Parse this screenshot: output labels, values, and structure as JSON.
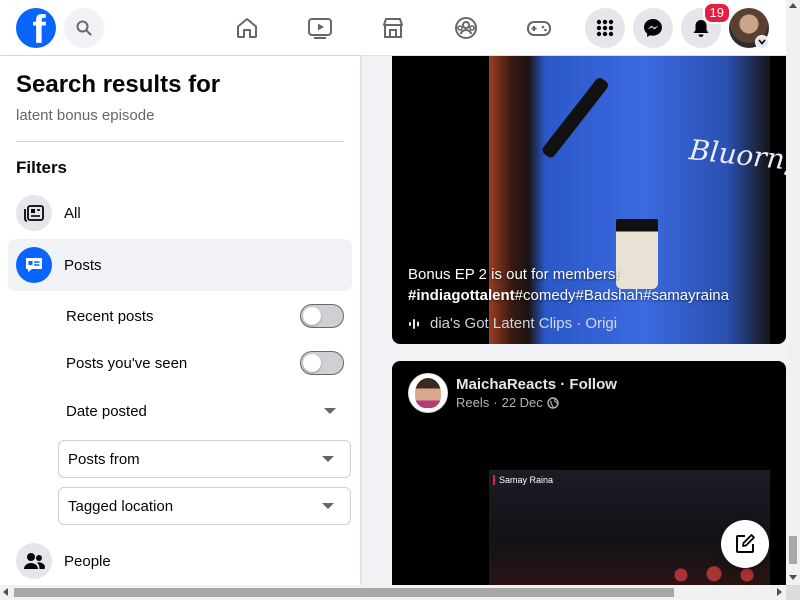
{
  "colors": {
    "brand": "#0866ff",
    "badge": "#e41e3f",
    "text_secondary": "#65676b"
  },
  "topbar": {
    "logo_icon": "facebook-logo-icon",
    "logo_letter": "f",
    "search_icon": "search-icon",
    "nav": [
      "home-icon",
      "watch-icon",
      "marketplace-icon",
      "groups-icon",
      "gaming-icon"
    ],
    "menu_icon": "menu-grid-icon",
    "messenger_icon": "messenger-icon",
    "notifications_icon": "bell-icon",
    "notifications_count": "19",
    "account_icon": "chevron-down-icon"
  },
  "sidebar": {
    "title": "Search results for",
    "query": "latent bonus episode",
    "filters_heading": "Filters",
    "filters": [
      {
        "label": "All",
        "icon": "all-results-icon"
      },
      {
        "label": "Posts",
        "icon": "posts-icon",
        "active": true
      }
    ],
    "post_options": {
      "recent_posts": {
        "label": "Recent posts",
        "on": false
      },
      "posts_seen": {
        "label": "Posts you've seen",
        "on": false
      },
      "date_posted": "Date posted",
      "posts_from": "Posts from",
      "tagged_location": "Tagged location"
    },
    "people": {
      "label": "People",
      "icon": "people-icon"
    }
  },
  "feed": {
    "post1": {
      "caption_line1": "Bonus EP 2 is out for members!",
      "hashtags": [
        "#indiagottalent",
        "#comedy",
        "#Badshah",
        "#samayraina"
      ],
      "audio_icon": "audio-wave-icon",
      "audio_text": "dia's Got Latent Clips · Origi",
      "shirt_text": "Bluorng"
    },
    "post2": {
      "author": "MaichaReacts",
      "follow": "Follow",
      "separator": "·",
      "meta_source": "Reels",
      "meta_date": "22 Dec",
      "privacy_icon": "globe-icon",
      "video_label": "Samay Raina"
    }
  },
  "compose_icon": "compose-icon"
}
